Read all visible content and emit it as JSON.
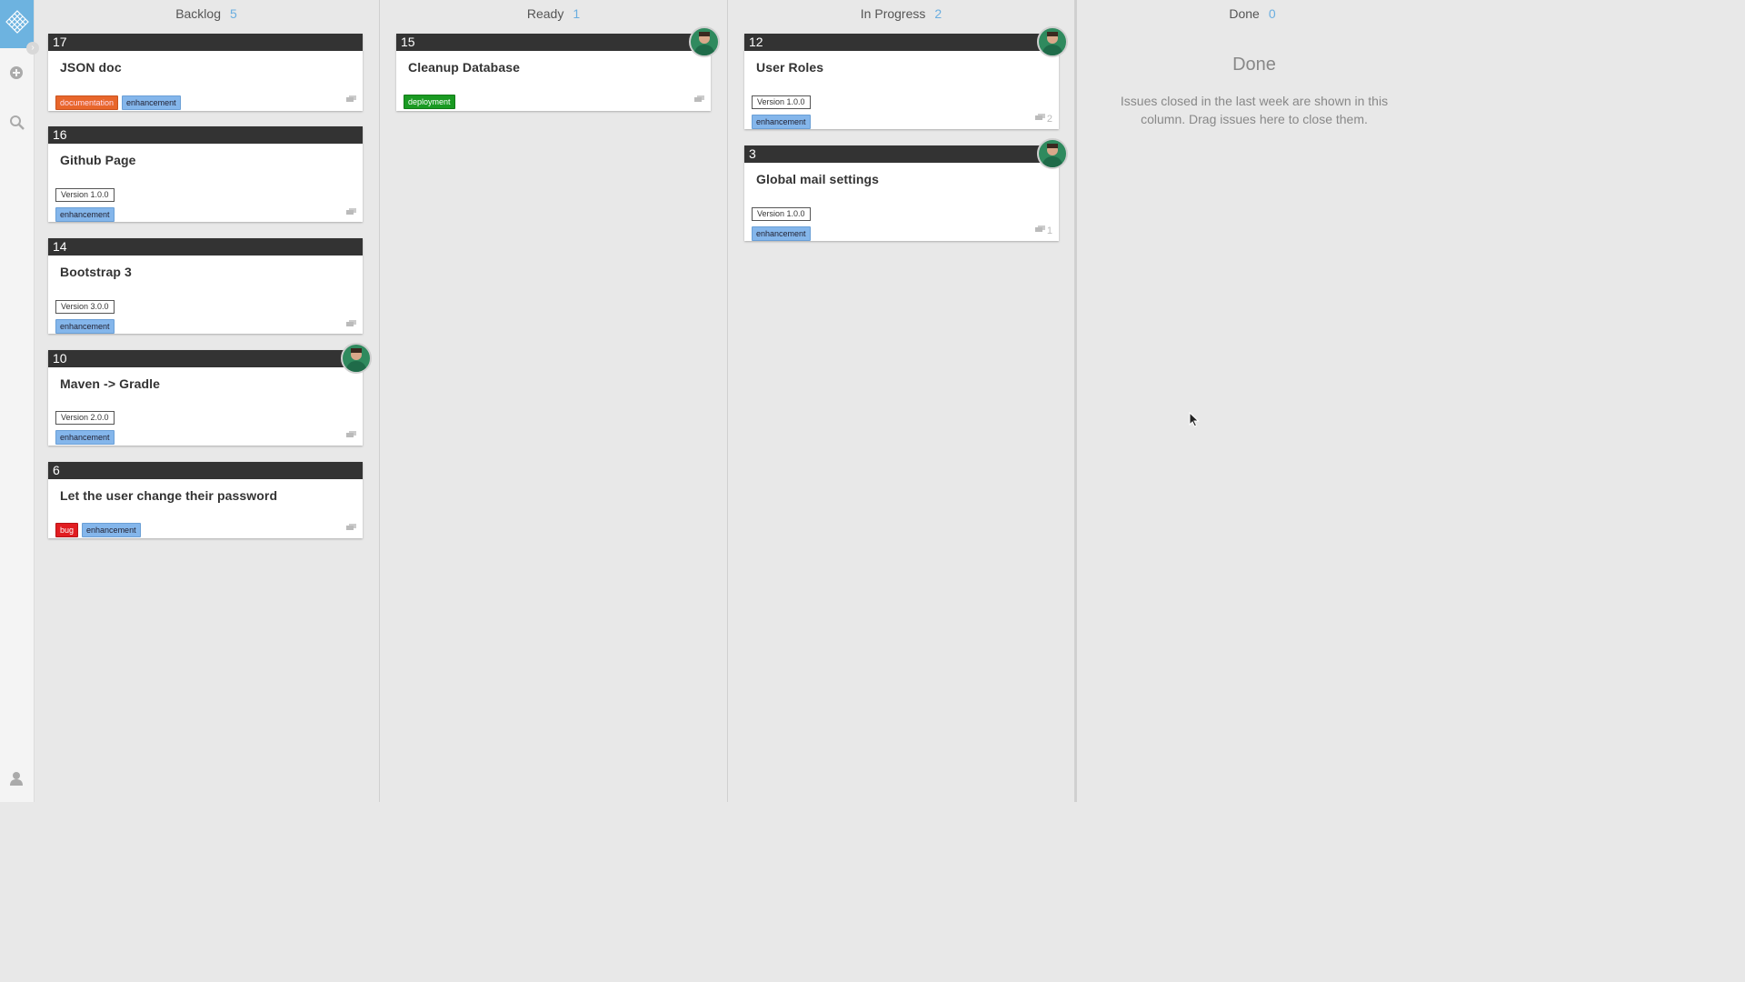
{
  "sidebar": {
    "logo_icon": "lattice-diamond-icon",
    "expand_icon": "chevron-right-icon",
    "add_icon": "plus-circle-icon",
    "search_icon": "search-icon",
    "user_icon": "user-icon"
  },
  "columns": [
    {
      "name": "Backlog",
      "count": "5"
    },
    {
      "name": "Ready",
      "count": "1"
    },
    {
      "name": "In Progress",
      "count": "2"
    },
    {
      "name": "Done",
      "count": "0"
    }
  ],
  "cards": {
    "c17": {
      "number": "17",
      "title": "JSON doc",
      "labels": [
        "documentation",
        "enhancement"
      ]
    },
    "c16": {
      "number": "16",
      "title": "Github Page",
      "milestone": "Version 1.0.0",
      "labels": [
        "enhancement"
      ]
    },
    "c14": {
      "number": "14",
      "title": "Bootstrap 3",
      "milestone": "Version 3.0.0",
      "labels": [
        "enhancement"
      ]
    },
    "c10": {
      "number": "10",
      "title": "Maven -> Gradle",
      "milestone": "Version 2.0.0",
      "labels": [
        "enhancement"
      ]
    },
    "c6": {
      "number": "6",
      "title": "Let the user change their password",
      "labels": [
        "bug",
        "enhancement"
      ]
    },
    "c15": {
      "number": "15",
      "title": "Cleanup Database",
      "labels": [
        "deployment"
      ]
    },
    "c12": {
      "number": "12",
      "title": "User Roles",
      "milestone": "Version 1.0.0",
      "labels": [
        "enhancement"
      ],
      "comment_count": "2"
    },
    "c3": {
      "number": "3",
      "title": "Global mail settings",
      "milestone": "Version 1.0.0",
      "labels": [
        "enhancement"
      ],
      "comment_count": "1"
    }
  },
  "done_panel": {
    "title": "Done",
    "text": "Issues closed in the last week are shown in this column. Drag issues here to close them."
  },
  "colors": {
    "accent": "#6db3e0",
    "card_header": "#333333",
    "enhancement": "#84b6eb",
    "documentation": "#e8662b",
    "deployment": "#1a9a22",
    "bug": "#e11d21"
  }
}
